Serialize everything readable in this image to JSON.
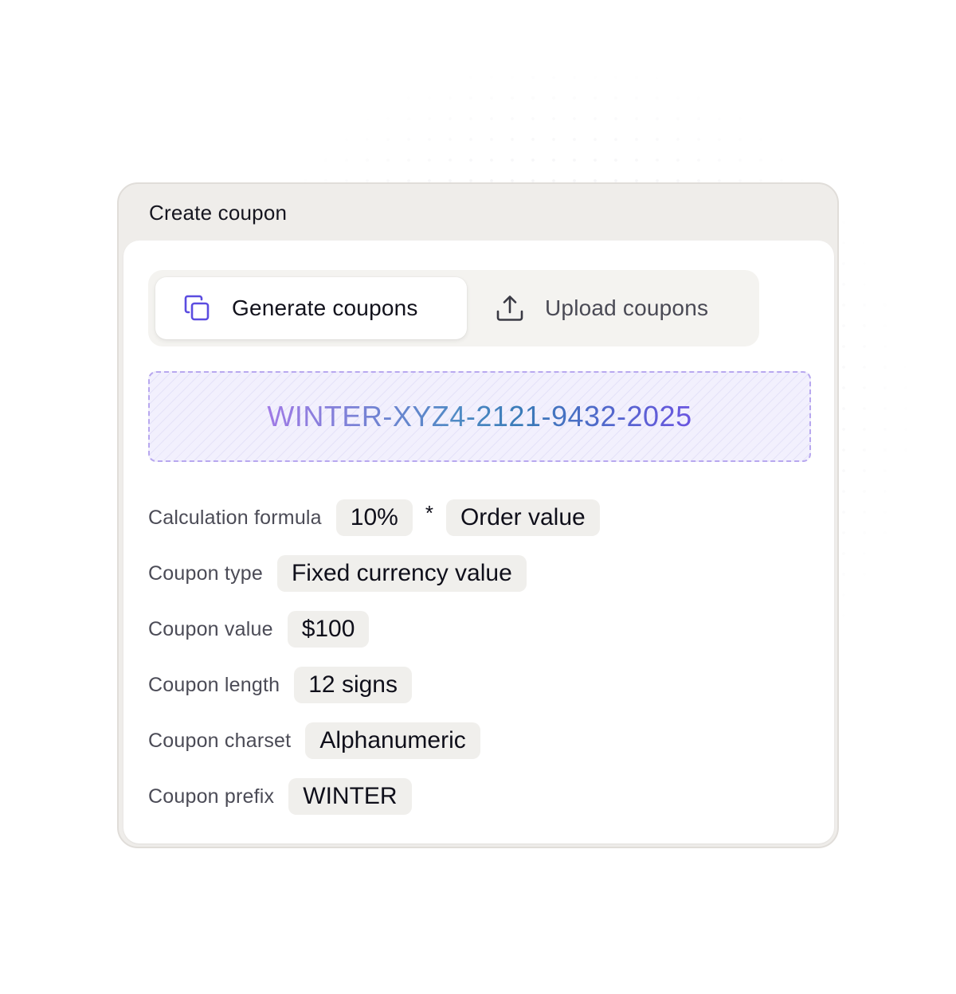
{
  "card": {
    "title": "Create coupon"
  },
  "tabs": [
    {
      "label": "Generate coupons",
      "icon": "copy-icon",
      "active": true
    },
    {
      "label": "Upload coupons",
      "icon": "upload-icon",
      "active": false
    }
  ],
  "coupon_preview": {
    "code": "WINTER-XYZ4-2121-9432-2025"
  },
  "settings": {
    "formula": {
      "label": "Calculation formula",
      "percent": "10%",
      "operator": "*",
      "base": "Order value"
    },
    "type": {
      "label": "Coupon type",
      "value": "Fixed currency value"
    },
    "value": {
      "label": "Coupon value",
      "value": "$100"
    },
    "length": {
      "label": "Coupon length",
      "value": "12 signs"
    },
    "charset": {
      "label": "Coupon charset",
      "value": "Alphanumeric"
    },
    "prefix": {
      "label": "Coupon prefix",
      "value": "WINTER"
    }
  },
  "colors": {
    "accent": "#5b4ce0",
    "card_header_bg": "#efedea",
    "chip_bg": "#f0efec",
    "code_border": "#b8a8ef",
    "code_bg": "#f2f0fd"
  }
}
